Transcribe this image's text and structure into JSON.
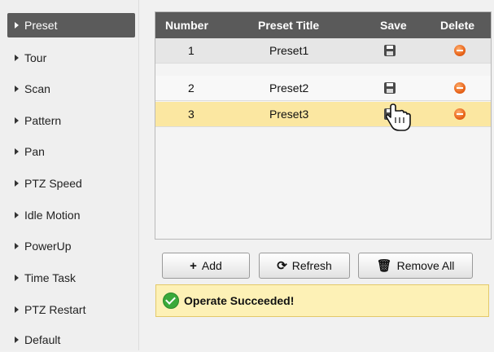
{
  "sidebar": {
    "items": [
      {
        "label": "Preset",
        "active": true
      },
      {
        "label": "Tour"
      },
      {
        "label": "Scan"
      },
      {
        "label": "Pattern"
      },
      {
        "label": "Pan"
      },
      {
        "label": "PTZ Speed"
      },
      {
        "label": "Idle Motion"
      },
      {
        "label": "PowerUp"
      },
      {
        "label": "Time Task"
      },
      {
        "label": "PTZ Restart"
      },
      {
        "label": "Default"
      }
    ]
  },
  "table": {
    "headers": {
      "number": "Number",
      "title": "Preset Title",
      "save": "Save",
      "delete": "Delete"
    },
    "rows": [
      {
        "number": "1",
        "title": "Preset1",
        "save_icon": "save-icon",
        "delete_icon": "delete-icon"
      },
      {
        "number": "2",
        "title": "Preset2",
        "save_icon": "save-icon",
        "delete_icon": "delete-icon"
      },
      {
        "number": "3",
        "title": "Preset3",
        "save_icon": "save-icon",
        "delete_icon": "delete-icon",
        "selected": true
      }
    ]
  },
  "toolbar": {
    "add_label": "Add",
    "refresh_label": "Refresh",
    "remove_all_label": "Remove All"
  },
  "status": {
    "message": "Operate Succeeded!",
    "icon": "check-icon"
  },
  "colors": {
    "header_bg": "#5a5a5a",
    "selected_row": "#fbe7a1",
    "notice_bg": "#fdf1b6",
    "delete_icon": "#e8641a",
    "success_icon": "#3aa93a"
  }
}
